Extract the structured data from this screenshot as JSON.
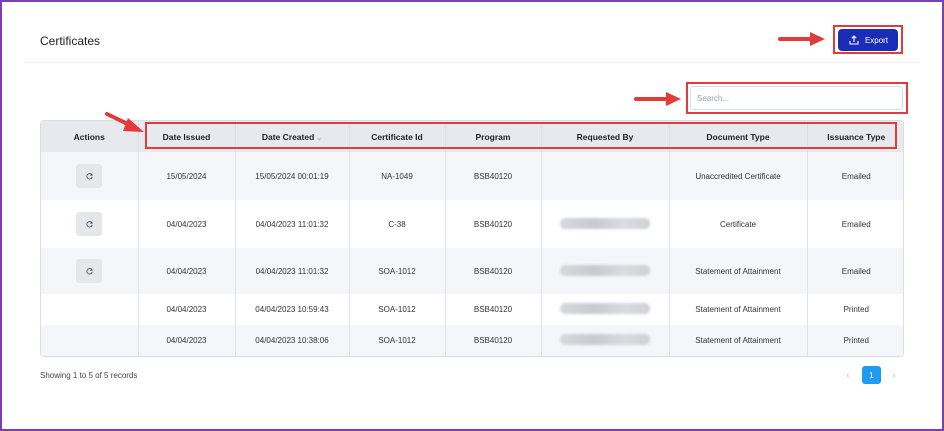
{
  "page": {
    "title": "Certificates"
  },
  "toolbar": {
    "export_label": "Export",
    "export_icon": "upload-icon"
  },
  "search": {
    "placeholder": "Search..."
  },
  "table": {
    "headers": {
      "actions": "Actions",
      "date_issued": "Date Issued",
      "date_created": "Date Created",
      "certificate_id": "Certificate Id",
      "program": "Program",
      "requested_by": "Requested By",
      "document_type": "Document Type",
      "issuance_type": "Issuance Type"
    },
    "sorted_column": "date_created",
    "rows": [
      {
        "has_action": true,
        "date_issued": "15/05/2024",
        "date_created": "15/05/2024 00:01:19",
        "certificate_id": "NA-1049",
        "program": "BSB40120",
        "requested_by_redacted": false,
        "document_type": "Unaccredited Certificate",
        "issuance_type": "Emailed"
      },
      {
        "has_action": true,
        "date_issued": "04/04/2023",
        "date_created": "04/04/2023 11:01:32",
        "certificate_id": "C-38",
        "program": "BSB40120",
        "requested_by_redacted": true,
        "document_type": "Certificate",
        "issuance_type": "Emailed"
      },
      {
        "has_action": true,
        "date_issued": "04/04/2023",
        "date_created": "04/04/2023 11:01:32",
        "certificate_id": "SOA-1012",
        "program": "BSB40120",
        "requested_by_redacted": true,
        "document_type": "Statement of Attainment",
        "issuance_type": "Emailed"
      },
      {
        "has_action": false,
        "date_issued": "04/04/2023",
        "date_created": "04/04/2023 10:59:43",
        "certificate_id": "SOA-1012",
        "program": "BSB40120",
        "requested_by_redacted": true,
        "document_type": "Statement of Attainment",
        "issuance_type": "Printed"
      },
      {
        "has_action": false,
        "date_issued": "04/04/2023",
        "date_created": "04/04/2023 10:38:06",
        "certificate_id": "SOA-1012",
        "program": "BSB40120",
        "requested_by_redacted": true,
        "document_type": "Statement of Attainment",
        "issuance_type": "Printed"
      }
    ]
  },
  "footer": {
    "records_text": "Showing 1 to 5 of 5 records"
  },
  "pagination": {
    "prev": "‹",
    "current_page": "1",
    "next": "›"
  },
  "colors": {
    "accent": "#1a2db5",
    "page_active": "#1f9cf0",
    "annotation": "#e23b3b",
    "frame": "#7b3fb0"
  }
}
